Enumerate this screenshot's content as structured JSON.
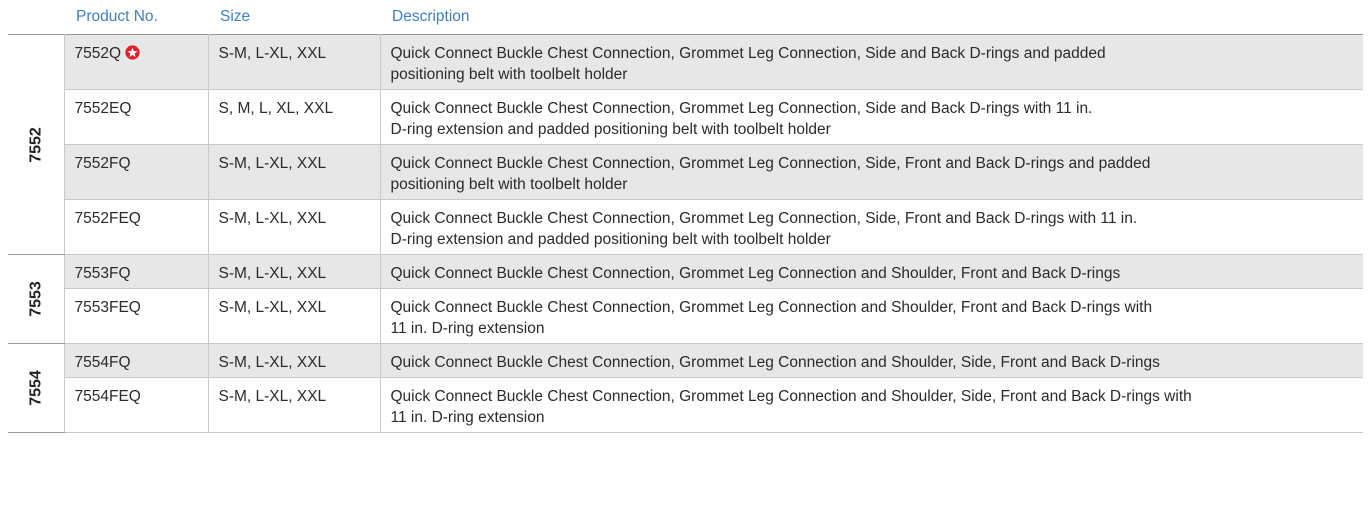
{
  "header": {
    "product_no": "Product No.",
    "size": "Size",
    "description": "Description"
  },
  "groups": [
    {
      "label": "7552",
      "rows": [
        {
          "product": "7552Q",
          "featured": true,
          "size": "S-M, L-XL, XXL",
          "description": "Quick Connect Buckle Chest Connection, Grommet Leg Connection, Side and Back D-rings and padded\npositioning belt with toolbelt holder"
        },
        {
          "product": "7552EQ",
          "featured": false,
          "size": "S, M, L, XL, XXL",
          "description": "Quick Connect Buckle Chest Connection, Grommet Leg Connection, Side and Back D-rings with 11 in.\nD-ring extension and padded positioning belt with toolbelt holder"
        },
        {
          "product": "7552FQ",
          "featured": false,
          "size": "S-M, L-XL, XXL",
          "description": "Quick Connect Buckle Chest Connection, Grommet Leg Connection, Side, Front and Back D-rings and padded\npositioning belt with toolbelt holder"
        },
        {
          "product": "7552FEQ",
          "featured": false,
          "size": "S-M, L-XL, XXL",
          "description": "Quick Connect Buckle Chest Connection, Grommet Leg Connection, Side, Front and Back D-rings with 11 in.\nD-ring extension and padded positioning belt with toolbelt holder"
        }
      ]
    },
    {
      "label": "7553",
      "rows": [
        {
          "product": "7553FQ",
          "featured": false,
          "size": "S-M, L-XL, XXL",
          "description": "Quick Connect Buckle Chest Connection, Grommet Leg Connection and Shoulder, Front and Back D-rings"
        },
        {
          "product": "7553FEQ",
          "featured": false,
          "size": "S-M, L-XL, XXL",
          "description": "Quick Connect Buckle Chest Connection, Grommet Leg Connection and Shoulder, Front and Back D-rings with\n11 in. D-ring extension"
        }
      ]
    },
    {
      "label": "7554",
      "rows": [
        {
          "product": "7554FQ",
          "featured": false,
          "size": "S-M, L-XL, XXL",
          "description": "Quick Connect Buckle Chest Connection, Grommet Leg Connection and Shoulder, Side, Front and Back D-rings"
        },
        {
          "product": "7554FEQ",
          "featured": false,
          "size": "S-M, L-XL, XXL",
          "description": "Quick Connect Buckle Chest Connection, Grommet Leg Connection and Shoulder, Side, Front and Back D-rings with\n11 in. D-ring extension"
        }
      ]
    }
  ],
  "icons": {
    "featured": "star-badge-icon"
  },
  "colors": {
    "header_text": "#3d7fc1",
    "row_shade": "#e7e7e7",
    "star_badge": "#e0202a"
  }
}
